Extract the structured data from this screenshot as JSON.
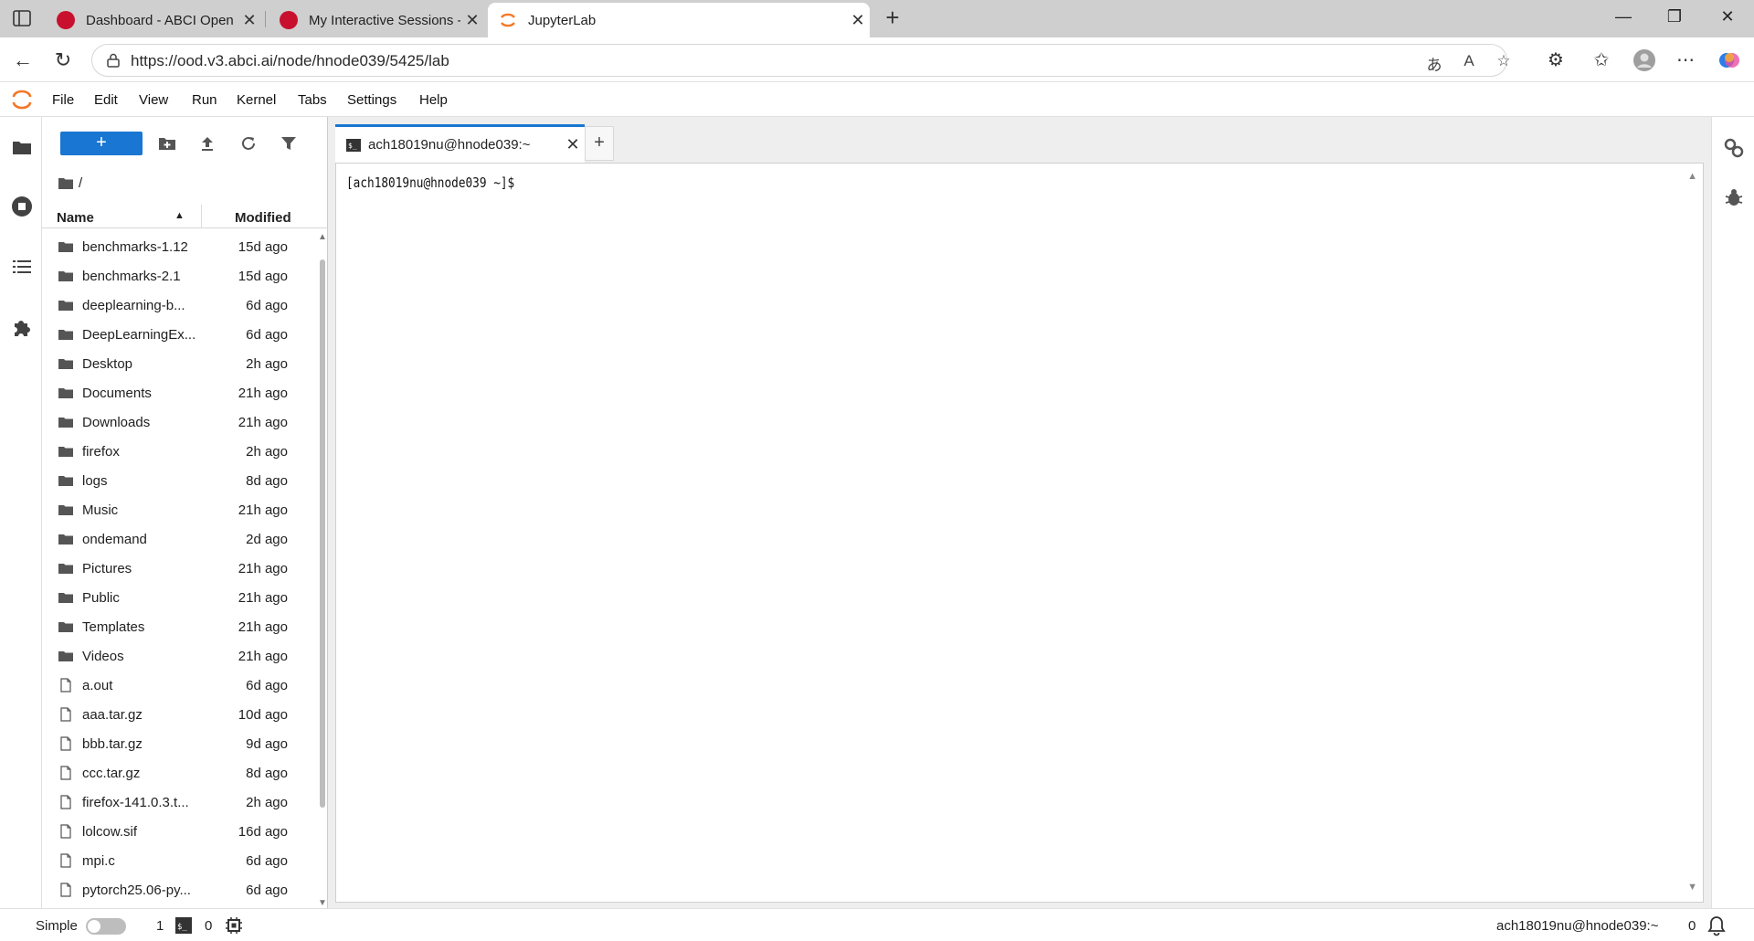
{
  "browser": {
    "tabs": [
      {
        "title": "Dashboard - ABCI Open OnDemand",
        "favicon": "ondemand-logo-icon",
        "active": false
      },
      {
        "title": "My Interactive Sessions - ABCI OpenOnDemand",
        "favicon": "ondemand-logo-icon",
        "active": false
      },
      {
        "title": "JupyterLab",
        "favicon": "jupyter-logo-icon",
        "active": true
      }
    ],
    "url": "https://ood.v3.abci.ai/node/hnode039/5425/lab",
    "close_glyph": "✕",
    "new_tab_glyph": "+"
  },
  "menu": {
    "items": [
      "File",
      "Edit",
      "View",
      "Run",
      "Kernel",
      "Tabs",
      "Settings",
      "Help"
    ]
  },
  "filebrowser": {
    "new_label": "+",
    "breadcrumb": "/",
    "columns": {
      "name": "Name",
      "modified": "Modified"
    },
    "files": [
      {
        "name": "benchmarks-1.12",
        "modified": "15d ago",
        "type": "folder"
      },
      {
        "name": "benchmarks-2.1",
        "modified": "15d ago",
        "type": "folder"
      },
      {
        "name": "deeplearning-b...",
        "modified": "6d ago",
        "type": "folder"
      },
      {
        "name": "DeepLearningEx...",
        "modified": "6d ago",
        "type": "folder"
      },
      {
        "name": "Desktop",
        "modified": "2h ago",
        "type": "folder"
      },
      {
        "name": "Documents",
        "modified": "21h ago",
        "type": "folder"
      },
      {
        "name": "Downloads",
        "modified": "21h ago",
        "type": "folder"
      },
      {
        "name": "firefox",
        "modified": "2h ago",
        "type": "folder"
      },
      {
        "name": "logs",
        "modified": "8d ago",
        "type": "folder"
      },
      {
        "name": "Music",
        "modified": "21h ago",
        "type": "folder"
      },
      {
        "name": "ondemand",
        "modified": "2d ago",
        "type": "folder"
      },
      {
        "name": "Pictures",
        "modified": "21h ago",
        "type": "folder"
      },
      {
        "name": "Public",
        "modified": "21h ago",
        "type": "folder"
      },
      {
        "name": "Templates",
        "modified": "21h ago",
        "type": "folder"
      },
      {
        "name": "Videos",
        "modified": "21h ago",
        "type": "folder"
      },
      {
        "name": "a.out",
        "modified": "6d ago",
        "type": "file"
      },
      {
        "name": "aaa.tar.gz",
        "modified": "10d ago",
        "type": "file"
      },
      {
        "name": "bbb.tar.gz",
        "modified": "9d ago",
        "type": "file"
      },
      {
        "name": "ccc.tar.gz",
        "modified": "8d ago",
        "type": "file"
      },
      {
        "name": "firefox-141.0.3.t...",
        "modified": "2h ago",
        "type": "file"
      },
      {
        "name": "lolcow.sif",
        "modified": "16d ago",
        "type": "file"
      },
      {
        "name": "mpi.c",
        "modified": "6d ago",
        "type": "file"
      },
      {
        "name": "pytorch25.06-py...",
        "modified": "6d ago",
        "type": "file"
      }
    ]
  },
  "document": {
    "tab_title": "ach18019nu@hnode039:~",
    "close_glyph": "✕",
    "add_glyph": "+",
    "terminal_text": "[ach18019nu@hnode039 ~]$"
  },
  "status": {
    "mode_label": "Simple",
    "terminals_count": "1",
    "kernels_count": "0",
    "right_text": "ach18019nu@hnode039:~",
    "notifications_count": "0"
  },
  "colors": {
    "accent": "#1976d2",
    "jupyter_orange": "#f37726",
    "ondemand_red": "#c8102e"
  }
}
